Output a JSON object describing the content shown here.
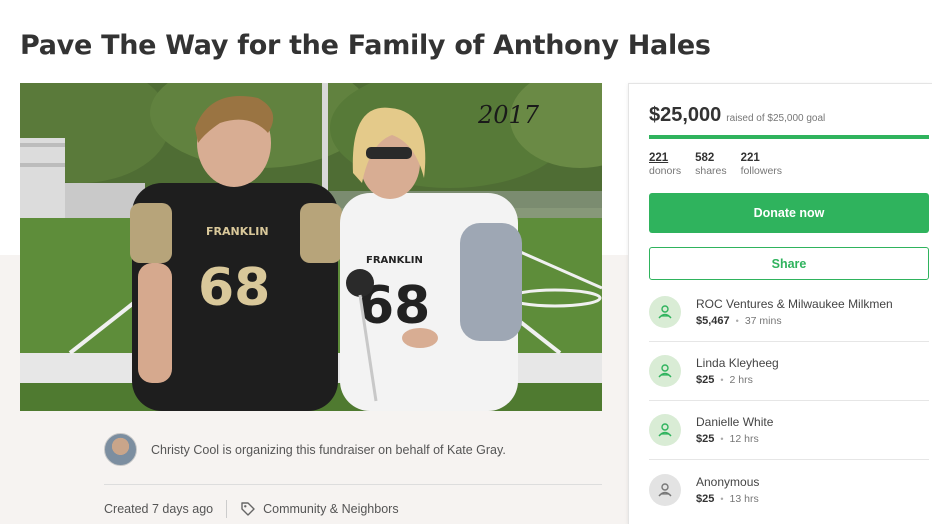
{
  "campaign": {
    "title": "Pave The Way for the Family of Anthony Hales",
    "photo_caption": "2017",
    "jersey_team": "FRANKLIN",
    "jersey_number": "68"
  },
  "organizer": {
    "text": "Christy Cool is organizing this fundraiser on behalf of Kate Gray."
  },
  "meta": {
    "created": "Created 7 days ago",
    "category": "Community & Neighbors"
  },
  "panel": {
    "raised_amount": "$25,000",
    "raised_goal": "raised of $25,000 goal",
    "progress_fraction": 1.0,
    "stats": [
      {
        "num": "221",
        "label": "donors"
      },
      {
        "num": "582",
        "label": "shares"
      },
      {
        "num": "221",
        "label": "followers"
      }
    ],
    "donate_label": "Donate now",
    "share_label": "Share",
    "donations": [
      {
        "name": "ROC Ventures & Milwaukee Milkmen",
        "amount": "$5,467",
        "time": "37 mins",
        "icon": "donor-icon"
      },
      {
        "name": "Linda Kleyheeg",
        "amount": "$25",
        "time": "2 hrs",
        "icon": "donor-icon"
      },
      {
        "name": "Danielle White",
        "amount": "$25",
        "time": "12 hrs",
        "icon": "donor-icon"
      },
      {
        "name": "Anonymous",
        "amount": "$25",
        "time": "13 hrs",
        "icon": "anonymous-donor-icon"
      }
    ]
  },
  "colors": {
    "accent": "#2fb35d",
    "text": "#333333",
    "muted": "#777777"
  }
}
